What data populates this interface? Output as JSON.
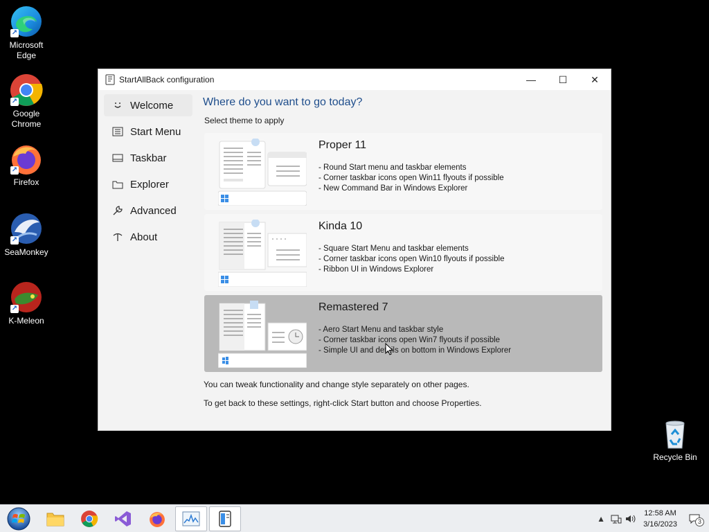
{
  "desktop": {
    "icons": [
      {
        "label": "Microsoft Edge",
        "name": "microsoft-edge-icon"
      },
      {
        "label": "Google Chrome",
        "name": "google-chrome-icon"
      },
      {
        "label": "Firefox",
        "name": "firefox-icon"
      },
      {
        "label": "SeaMonkey",
        "name": "seamonkey-icon"
      },
      {
        "label": "K-Meleon",
        "name": "k-meleon-icon"
      }
    ],
    "recycle_bin": "Recycle Bin"
  },
  "window": {
    "title": "StartAllBack configuration",
    "controls": {
      "minimize": "—",
      "maximize": "☐",
      "close": "✕"
    }
  },
  "sidebar": {
    "items": [
      {
        "label": "Welcome",
        "icon": "smiley-icon",
        "active": true
      },
      {
        "label": "Start Menu",
        "icon": "start-menu-icon",
        "active": false
      },
      {
        "label": "Taskbar",
        "icon": "taskbar-icon",
        "active": false
      },
      {
        "label": "Explorer",
        "icon": "explorer-icon",
        "active": false
      },
      {
        "label": "Advanced",
        "icon": "wrench-icon",
        "active": false
      },
      {
        "label": "About",
        "icon": "info-icon",
        "active": false
      }
    ]
  },
  "main": {
    "heading": "Where do you want to go today?",
    "subheading": "Select theme to apply",
    "themes": [
      {
        "name": "Proper 11",
        "bullets": [
          "- Round Start menu and taskbar elements",
          "- Corner taskbar icons open Win11 flyouts if possible",
          "- New Command Bar in Windows Explorer"
        ],
        "selected": false
      },
      {
        "name": "Kinda 10",
        "bullets": [
          "- Square Start Menu and taskbar elements",
          "- Corner taskbar icons open Win10 flyouts if possible",
          "- Ribbon UI in Windows Explorer"
        ],
        "selected": false
      },
      {
        "name": "Remastered 7",
        "bullets": [
          "- Aero Start Menu and taskbar style",
          "- Corner taskbar icons open Win7 flyouts if possible",
          "- Simple UI and details on bottom in Windows Explorer"
        ],
        "selected": true
      }
    ],
    "footer1": "You can tweak functionality and change style separately on other pages.",
    "footer2": "To get back to these settings, right-click Start button and choose Properties."
  },
  "taskbar": {
    "apps": [
      {
        "name": "start-button",
        "active": false
      },
      {
        "name": "file-explorer-icon",
        "active": false
      },
      {
        "name": "chrome-taskbar-icon",
        "active": false
      },
      {
        "name": "visual-studio-icon",
        "active": false
      },
      {
        "name": "firefox-taskbar-icon",
        "active": false
      },
      {
        "name": "resource-monitor-icon",
        "active": true
      },
      {
        "name": "startallback-taskbar-icon",
        "active": true
      }
    ],
    "clock_time": "12:58 AM",
    "clock_date": "3/16/2023",
    "notification_count": "3"
  },
  "colors": {
    "accent": "#1f4e8c",
    "selected_card": "#b9b9b9",
    "window_bg": "#f3f3f3"
  }
}
